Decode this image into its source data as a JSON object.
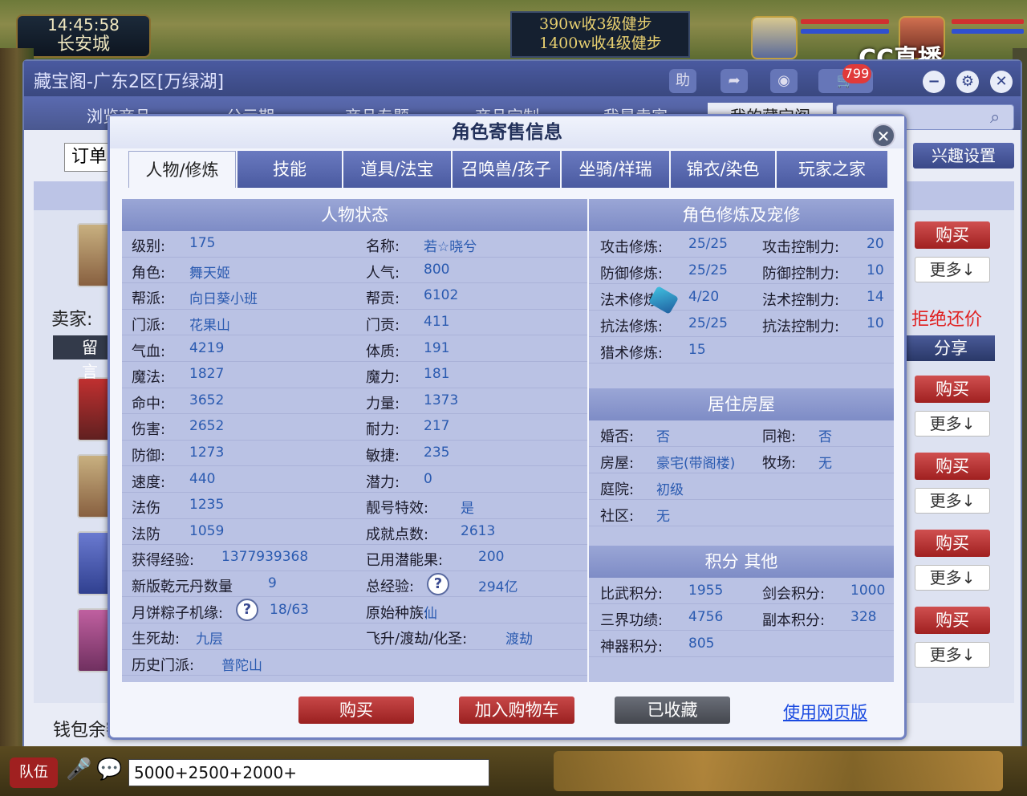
{
  "hud": {
    "time": "14:45:58",
    "location": "长安城",
    "banner_line1": "390w收3级健步",
    "banner_line2": "1400w收4级健步",
    "stream_logo": "CC直播",
    "cart_count": "799"
  },
  "main": {
    "title": "藏宝阁-广东2区[万绿湖]",
    "tabs": [
      "浏览商品",
      "公示期",
      "商品专题",
      "商品定制",
      "我是卖家",
      "我的藏宝阁"
    ],
    "help_label": "助",
    "order_label": "订单",
    "interest_label": "兴趣设置",
    "seller_label": "卖家:",
    "leave_msg": "留言",
    "refuse_label": "拒绝还价",
    "share_label": "分享",
    "buy_label": "购买",
    "more_label": "更多↓",
    "wallet_label": "钱包余额"
  },
  "dialog": {
    "title": "角色寄售信息",
    "tabs": [
      "人物/修炼",
      "技能",
      "道具/法宝",
      "召唤兽/孩子",
      "坐骑/祥瑞",
      "锦衣/染色",
      "玩家之家"
    ],
    "left_header": "人物状态",
    "left_rows": [
      {
        "l1": "级别:",
        "v1": "175",
        "l2": "名称:",
        "v2": "若☆晓兮"
      },
      {
        "l1": "角色:",
        "v1": "舞天姬",
        "l2": "人气:",
        "v2": "800"
      },
      {
        "l1": "帮派:",
        "v1": "向日葵小班",
        "l2": "帮贡:",
        "v2": "6102"
      },
      {
        "l1": "门派:",
        "v1": "花果山",
        "l2": "门贡:",
        "v2": "411"
      },
      {
        "l1": "气血:",
        "v1": "4219",
        "l2": "体质:",
        "v2": "191"
      },
      {
        "l1": "魔法:",
        "v1": "1827",
        "l2": "魔力:",
        "v2": "181"
      },
      {
        "l1": "命中:",
        "v1": "3652",
        "l2": "力量:",
        "v2": "1373"
      },
      {
        "l1": "伤害:",
        "v1": "2652",
        "l2": "耐力:",
        "v2": "217"
      },
      {
        "l1": "防御:",
        "v1": "1273",
        "l2": "敏捷:",
        "v2": "235"
      },
      {
        "l1": "速度:",
        "v1": "440",
        "l2": "潜力:",
        "v2": "0"
      },
      {
        "l1": "法伤",
        "v1": "1235",
        "l2": "靓号特效:",
        "v2": "是"
      },
      {
        "l1": "法防",
        "v1": "1059",
        "l2": "成就点数:",
        "v2": "2613"
      },
      {
        "l1": "获得经验:",
        "v1": "1377939368",
        "l2": "已用潜能果:",
        "v2": "200"
      },
      {
        "l1": "新版乾元丹数量",
        "v1": "9",
        "l2": "总经验:",
        "v2": "294亿"
      },
      {
        "l1": "月饼粽子机缘:",
        "v1": "18/63",
        "l2": "原始种族:",
        "v2": "仙"
      },
      {
        "l1": "生死劫:",
        "v1": "九层",
        "l2": "飞升/渡劫/化圣:",
        "v2": "渡劫"
      },
      {
        "l1": "历史门派:",
        "v1": "普陀山",
        "l2": "",
        "v2": ""
      }
    ],
    "right_header1": "角色修炼及宠修",
    "cultivation_rows": [
      {
        "l1": "攻击修炼:",
        "v1": "25/25",
        "l2": "攻击控制力:",
        "v2": "20"
      },
      {
        "l1": "防御修炼:",
        "v1": "25/25",
        "l2": "防御控制力:",
        "v2": "10"
      },
      {
        "l1": "法术修炼:",
        "v1": "4/20",
        "l2": "法术控制力:",
        "v2": "14"
      },
      {
        "l1": "抗法修炼:",
        "v1": "25/25",
        "l2": "抗法控制力:",
        "v2": "10"
      },
      {
        "l1": "猎术修炼:",
        "v1": "15",
        "l2": "",
        "v2": ""
      }
    ],
    "right_header2": "居住房屋",
    "house_rows": [
      {
        "l1": "婚否:",
        "v1": "否",
        "l2": "同袍:",
        "v2": "否"
      },
      {
        "l1": "房屋:",
        "v1": "豪宅(带阁楼)",
        "l2": "牧场:",
        "v2": "无"
      },
      {
        "l1": "庭院:",
        "v1": "初级",
        "l2": "",
        "v2": ""
      },
      {
        "l1": "社区:",
        "v1": "无",
        "l2": "",
        "v2": ""
      }
    ],
    "right_header3": "积分 其他",
    "points_rows": [
      {
        "l1": "比武积分:",
        "v1": "1955",
        "l2": "剑会积分:",
        "v2": "1000"
      },
      {
        "l1": "三界功绩:",
        "v1": "4756",
        "l2": "副本积分:",
        "v2": "328"
      },
      {
        "l1": "神器积分:",
        "v1": "805",
        "l2": "",
        "v2": ""
      }
    ],
    "buy_button": "购买",
    "cart_button": "加入购物车",
    "collected_button": "已收藏",
    "web_link": "使用网页版"
  },
  "bottom": {
    "team_label": "队伍",
    "chat_text": "5000+2500+2000+"
  },
  "colors": {
    "dialog_border": "#7080c0",
    "panel_header": "#7e8cc6",
    "buy_red": "#b02828",
    "value_blue": "#2a5ab0"
  }
}
